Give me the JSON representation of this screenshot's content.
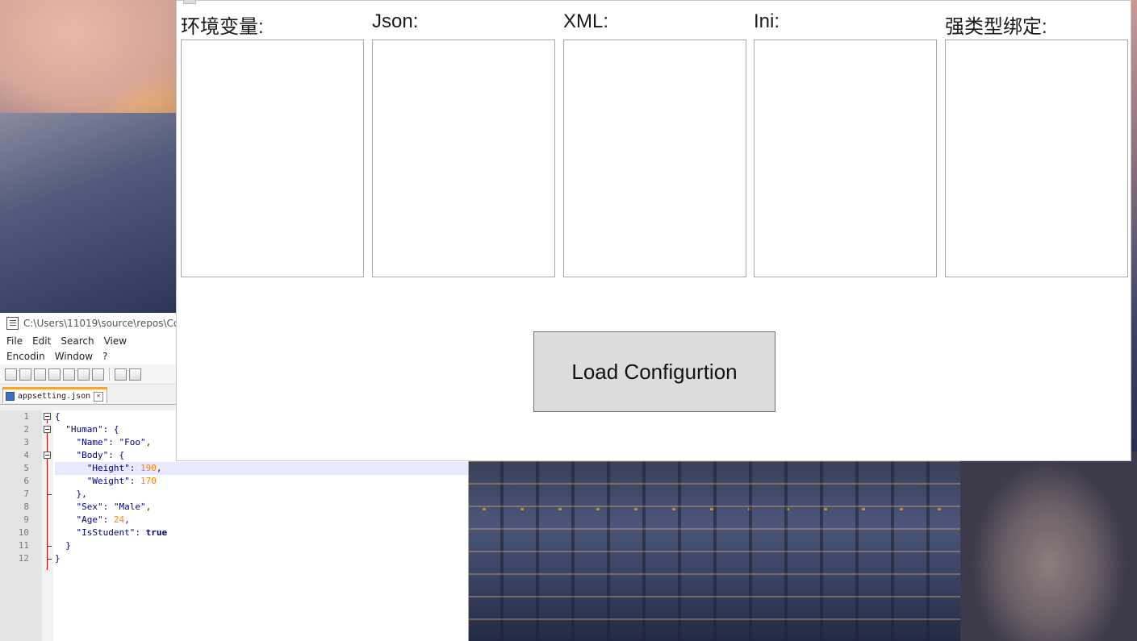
{
  "notepad": {
    "title_path": "C:\\Users\\11019\\source\\repos\\Co",
    "menu": [
      "File",
      "Edit",
      "Search",
      "View",
      "Encodin",
      "Window",
      "?"
    ],
    "tab_label": "appsetting.json",
    "line_numbers": [
      "1",
      "2",
      "3",
      "4",
      "5",
      "6",
      "7",
      "8",
      "9",
      "10",
      "11",
      "12"
    ],
    "code": {
      "l1": "{",
      "l2_key": "\"Human\"",
      "l2_rest": ": {",
      "l3_key": "\"Name\"",
      "l3_colon": ": ",
      "l3_val": "\"Foo\"",
      "l3_comma": ",",
      "l4_key": "\"Body\"",
      "l4_rest": ": {",
      "l5_key": "\"Height\"",
      "l5_colon": ": ",
      "l5_val": "190",
      "l5_comma": ",",
      "l6_key": "\"Weight\"",
      "l6_colon": ": ",
      "l6_val": "170",
      "l7": "},",
      "l8_key": "\"Sex\"",
      "l8_colon": ": ",
      "l8_val": "\"Male\"",
      "l8_comma": ",",
      "l9_key": "\"Age\"",
      "l9_colon": ": ",
      "l9_val": "24",
      "l9_comma": ",",
      "l10_key": "\"IsStudent\"",
      "l10_colon": ": ",
      "l10_val": "true",
      "l11": "}",
      "l12": "}"
    }
  },
  "app": {
    "columns": [
      {
        "label": "环境变量:"
      },
      {
        "label": "Json:"
      },
      {
        "label": "XML:"
      },
      {
        "label": "Ini:"
      },
      {
        "label": "强类型绑定:"
      }
    ],
    "load_button": "Load Configurtion"
  },
  "colors": {
    "code_key": "#000080",
    "code_string": "#808080",
    "code_number": "#ff8000",
    "tab_accent": "#f3a43a",
    "button_bg": "#dddddd"
  }
}
